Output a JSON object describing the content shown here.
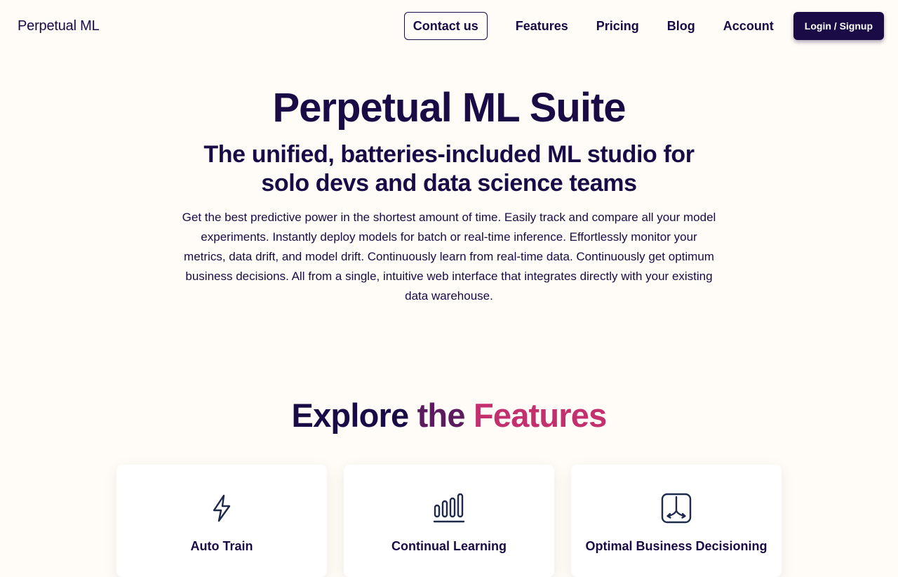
{
  "brand": "Perpetual ML",
  "nav": {
    "contact": "Contact us",
    "features": "Features",
    "pricing": "Pricing",
    "blog": "Blog",
    "account": "Account",
    "login": "Login / Signup"
  },
  "hero": {
    "title": "Perpetual ML Suite",
    "subtitle": "The unified, batteries-included ML studio for solo devs and data science teams",
    "description": "Get the best predictive power in the shortest amount of time. Easily track and compare all your model experiments. Instantly deploy models for batch or real-time inference. Effortlessly monitor your metrics, data drift, and model drift. Continuously learn from real-time data. Continuously get optimum business decisions. All from a single, intuitive web interface that integrates directly with your existing data warehouse."
  },
  "features_section": {
    "title_words": [
      "Explore",
      "the",
      "Features"
    ]
  },
  "features": [
    {
      "title": "Auto Train",
      "icon": "lightning-icon"
    },
    {
      "title": "Continual Learning",
      "icon": "bar-chart-icon"
    },
    {
      "title": "Optimal Business Decisioning",
      "icon": "decision-split-icon"
    }
  ],
  "colors": {
    "primary": "#1a0a45",
    "background": "#fffbf6",
    "gradient_mid": "#5c1a5f",
    "gradient_end": "#c2306e",
    "icon": "#1e2a4a"
  }
}
